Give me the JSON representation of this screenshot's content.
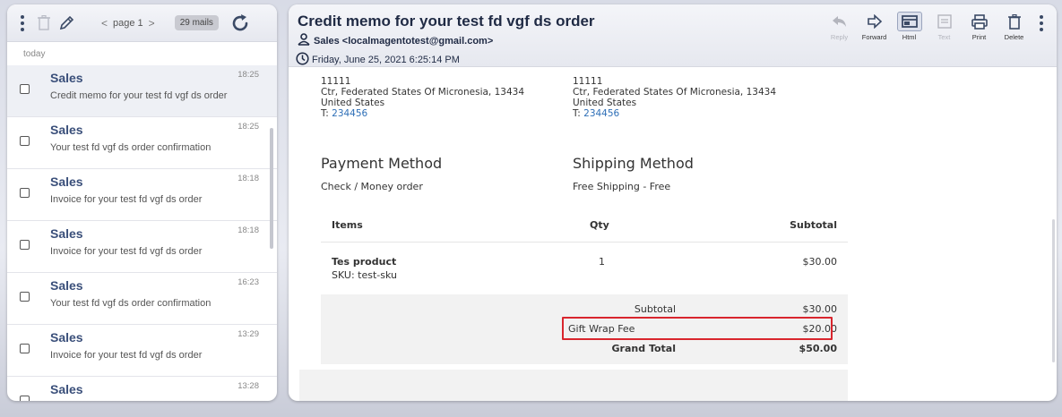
{
  "toolbar": {
    "page_label": "page 1",
    "mail_count": "29 mails"
  },
  "list": {
    "section_label": "today",
    "items": [
      {
        "sender": "Sales",
        "time": "18:25",
        "subject": "Credit memo for your test fd vgf ds order",
        "selected": true
      },
      {
        "sender": "Sales",
        "time": "18:25",
        "subject": "Your test fd vgf ds order confirmation",
        "selected": false
      },
      {
        "sender": "Sales",
        "time": "18:18",
        "subject": "Invoice for your test fd vgf ds order",
        "selected": false
      },
      {
        "sender": "Sales",
        "time": "18:18",
        "subject": "Invoice for your test fd vgf ds order",
        "selected": false
      },
      {
        "sender": "Sales",
        "time": "16:23",
        "subject": "Your test fd vgf ds order confirmation",
        "selected": false
      },
      {
        "sender": "Sales",
        "time": "13:29",
        "subject": "Invoice for your test fd vgf ds order",
        "selected": false
      },
      {
        "sender": "Sales",
        "time": "13:28",
        "subject": "",
        "selected": false
      }
    ]
  },
  "message": {
    "title": "Credit memo for your test fd vgf ds order",
    "from": "Sales <localmagentotest@gmail.com>",
    "date": "Friday, June 25, 2021 6:25:14 PM",
    "actions": {
      "reply": "Reply",
      "forward": "Forward",
      "html": "Html",
      "text": "Text",
      "print": "Print",
      "delete": "Delete"
    }
  },
  "body": {
    "billing": {
      "line1": "11111",
      "line2": "Ctr, Federated States Of Micronesia, 13434",
      "line3": "United States",
      "phone_prefix": "T: ",
      "phone": "234456"
    },
    "shipping": {
      "line1": "11111",
      "line2": "Ctr, Federated States Of Micronesia, 13434",
      "line3": "United States",
      "phone_prefix": "T: ",
      "phone": "234456"
    },
    "payment_heading": "Payment Method",
    "payment_value": "Check / Money order",
    "shipping_heading": "Shipping Method",
    "shipping_value": "Free Shipping - Free",
    "table": {
      "col_items": "Items",
      "col_qty": "Qty",
      "col_subtotal": "Subtotal",
      "product_name": "Tes product",
      "product_sku": "SKU: test-sku",
      "product_qty": "1",
      "product_subtotal": "$30.00"
    },
    "totals": {
      "subtotal_label": "Subtotal",
      "subtotal_value": "$30.00",
      "giftwrap_label": "Gift Wrap Fee",
      "giftwrap_value": "$20.00",
      "grand_label": "Grand Total",
      "grand_value": "$50.00"
    }
  },
  "colors": {
    "accent": "#3a4f7a",
    "highlight": "#d9262e",
    "link": "#2e6fb7"
  }
}
